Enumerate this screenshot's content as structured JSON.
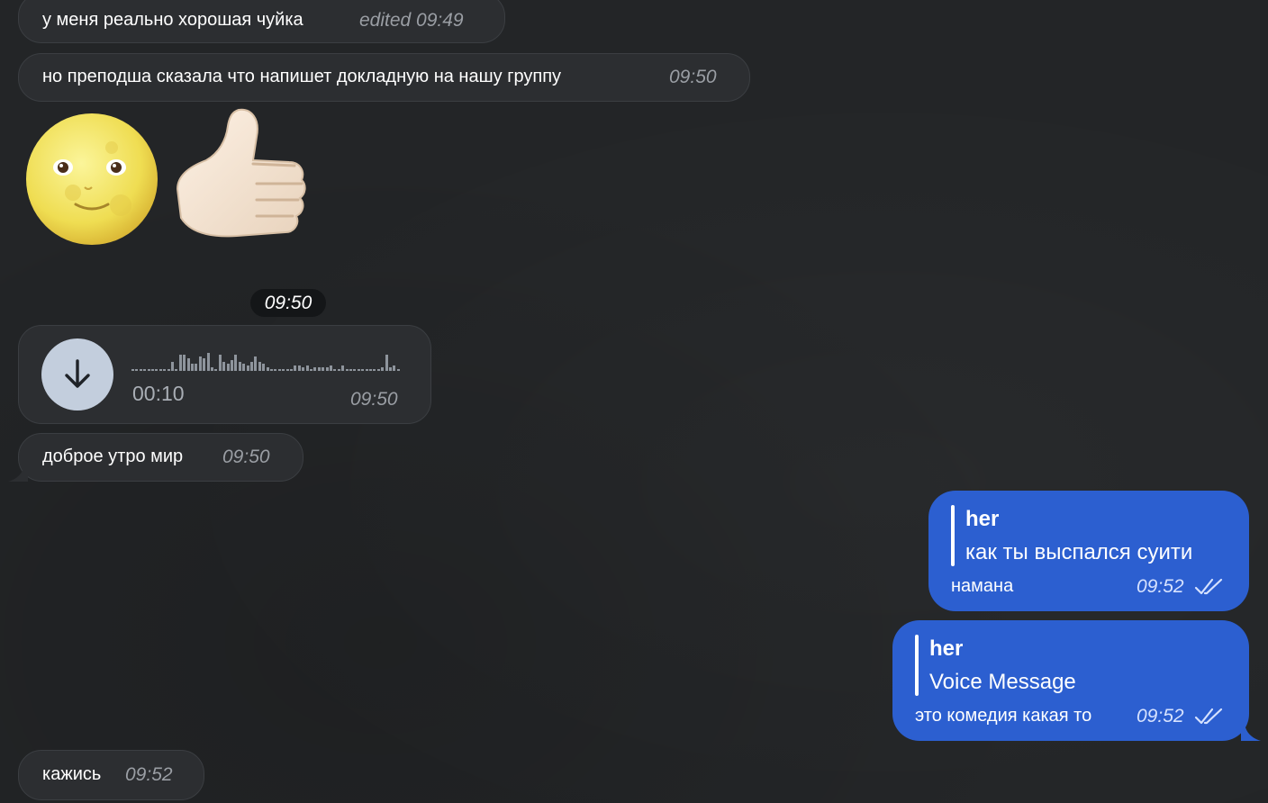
{
  "messages_in": [
    {
      "text": "у меня реально хорошая чуйка",
      "time": "edited 09:49"
    },
    {
      "text": "но преподша сказала что напишет докладную на нашу группу",
      "time": "09:50"
    },
    {
      "text": "доброе утро мир",
      "time": "09:50"
    },
    {
      "text": "кажись",
      "time": "09:52"
    }
  ],
  "stickers": {
    "icons": [
      "full-moon-face-icon",
      "thumbs-up-icon"
    ],
    "time": "09:50"
  },
  "voice_message": {
    "duration": "00:10",
    "time": "09:50",
    "icon": "download-arrow-icon"
  },
  "messages_out": [
    {
      "reply_name": "her",
      "reply_text": "как ты выспался суити",
      "text": "намана",
      "time": "09:52",
      "status_icon": "double-check-icon"
    },
    {
      "reply_name": "her",
      "reply_text": "Voice Message",
      "text": "это комедия какая то",
      "time": "09:52",
      "status_icon": "double-check-icon"
    }
  ],
  "colors": {
    "background": "#232527",
    "incoming_bubble": "#2c2e31",
    "outgoing_bubble": "#2c5fd0",
    "timestamp": "#9a9ea4",
    "voice_button": "#c3cedd"
  }
}
